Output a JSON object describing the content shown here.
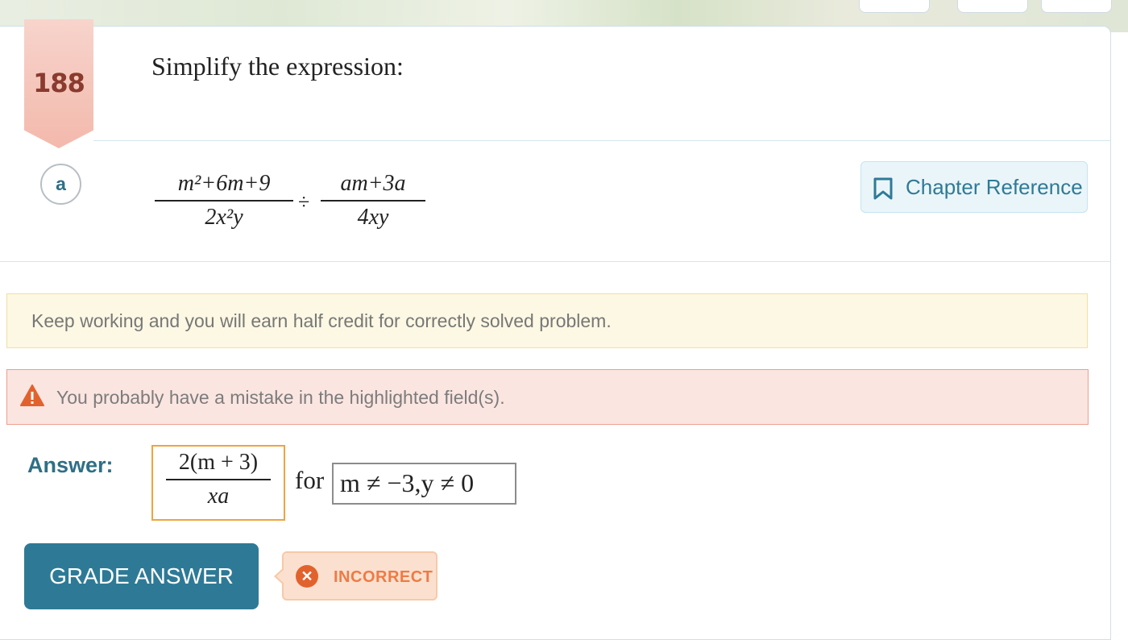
{
  "question": {
    "number": "188",
    "title": "Simplify the expression:"
  },
  "part": {
    "label": "a",
    "expression": {
      "left_numerator": "m²+6m+9",
      "left_denominator": "2x²y",
      "operator": "÷",
      "right_numerator": "am+3a",
      "right_denominator": "4xy"
    },
    "chapter_reference": {
      "label": "Chapter Reference",
      "icon": "bookmark-icon"
    }
  },
  "notices": {
    "half_credit": "Keep working and you will earn half credit for correctly solved problem.",
    "mistake": "You probably have a mistake in the highlighted field(s).",
    "mistake_icon": "warning-icon"
  },
  "answer": {
    "label": "Answer:",
    "numerator": "2(m + 3)",
    "denominator": "xa",
    "for_text": "for",
    "condition": "m ≠ −3,y ≠ 0"
  },
  "actions": {
    "grade_label": "GRADE ANSWER",
    "result_label": "INCORRECT",
    "result_icon": "x-circle-icon"
  },
  "colors": {
    "accent": "#2e7a96",
    "ribbon": "#f3b9ac",
    "error_border": "#f0a43c",
    "incorrect_text": "#ee7b45"
  }
}
